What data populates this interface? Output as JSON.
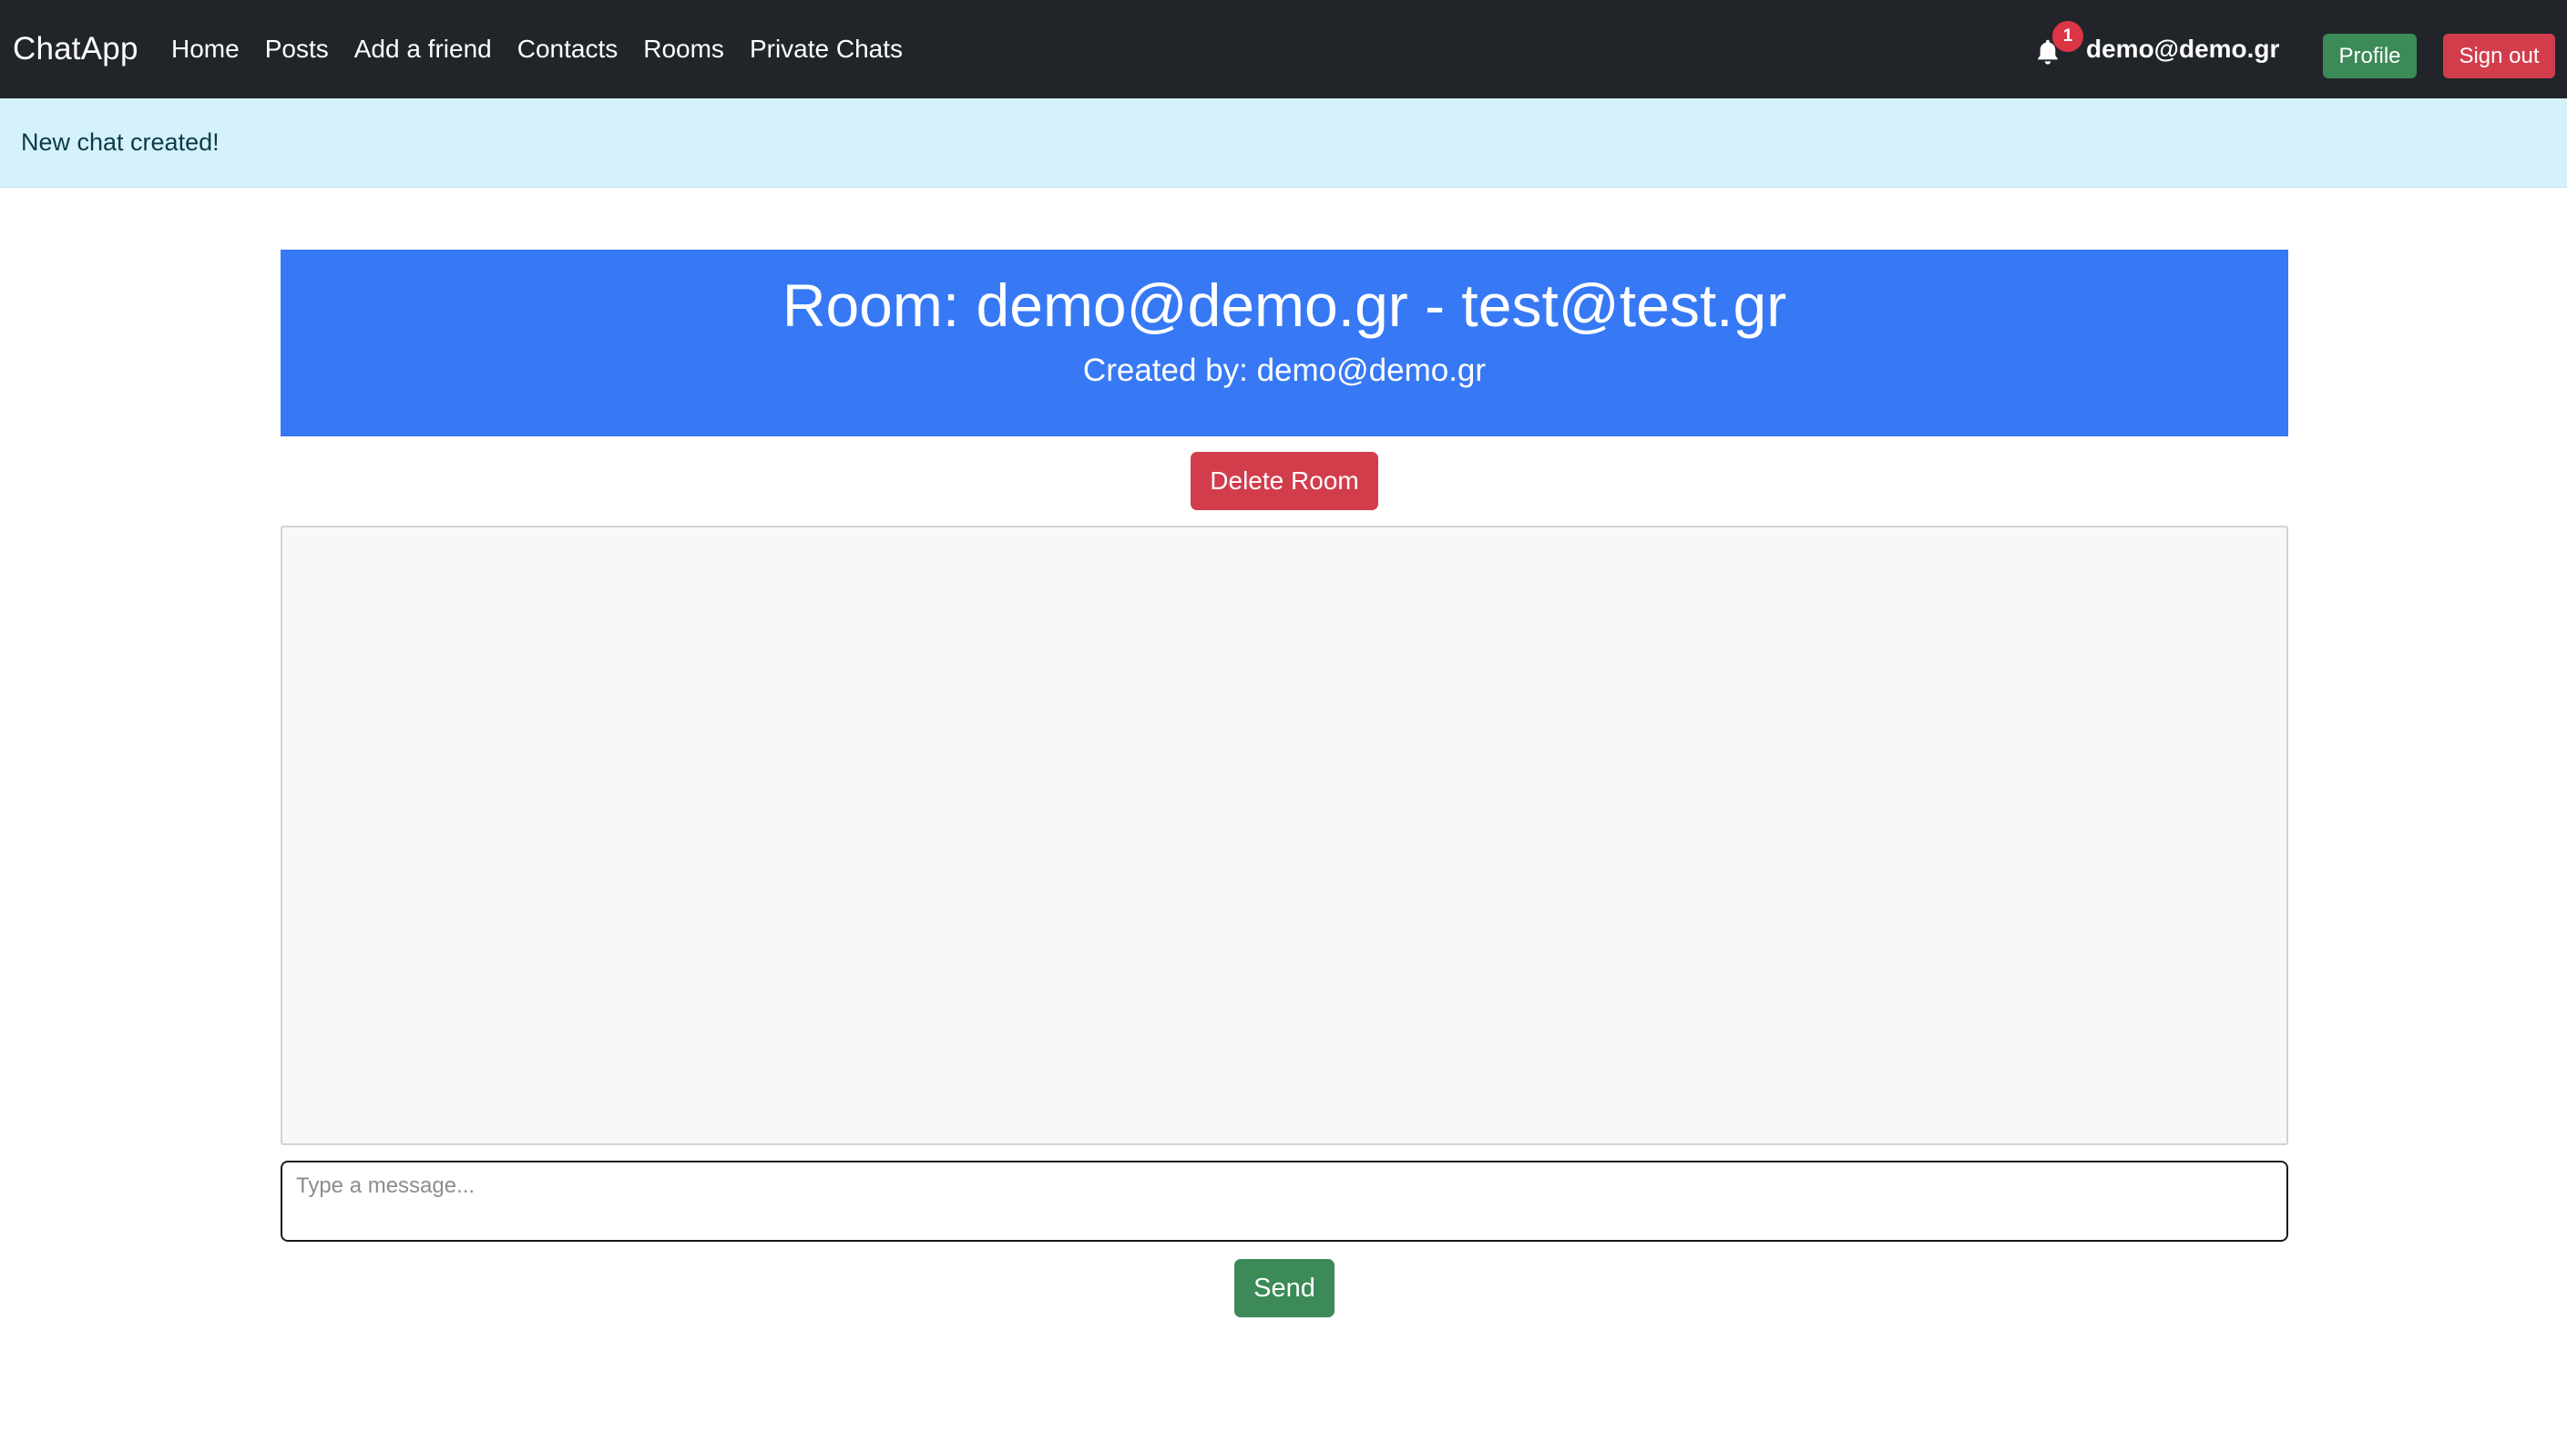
{
  "navbar": {
    "brand": "ChatApp",
    "links": [
      "Home",
      "Posts",
      "Add a friend",
      "Contacts",
      "Rooms",
      "Private Chats"
    ],
    "notification_icon": "bell-icon",
    "notification_count": "1",
    "user_email": "demo@demo.gr",
    "profile_label": "Profile",
    "signout_label": "Sign out"
  },
  "alert": {
    "message": "New chat created!"
  },
  "room": {
    "title": "Room: demo@demo.gr - test@test.gr",
    "created_by": "Created by: demo@demo.gr",
    "delete_label": "Delete Room"
  },
  "composer": {
    "placeholder": "Type a message...",
    "value": "",
    "send_label": "Send"
  },
  "colors": {
    "navbar_bg": "#212529",
    "alert_bg": "#d5f2fb",
    "room_header_bg": "#3779f5",
    "danger": "#d23d4c",
    "success": "#3b8a57",
    "chat_bg": "#f8f8f8"
  }
}
